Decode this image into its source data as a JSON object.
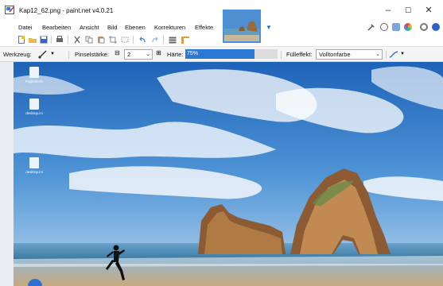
{
  "window": {
    "title": "Kap12_62.png - paint.net v4.0.21",
    "controls": {
      "minimize": "–",
      "maximize": "☐",
      "close": "✕"
    }
  },
  "menu": {
    "items": [
      "Datei",
      "Bearbeiten",
      "Ansicht",
      "Bild",
      "Ebenen",
      "Korrekturen",
      "Effekte"
    ]
  },
  "options_bar": {
    "tool_label": "Werkzeug:",
    "brush_width_label": "Pinselstärke:",
    "brush_width_value": "2",
    "hardness_label": "Härte:",
    "hardness_value": "75%",
    "hardness_fraction": 0.75,
    "fill_label": "Fülleffekt:",
    "fill_value": "Volltonfarbe"
  },
  "desktop": {
    "icons": [
      {
        "label": "Papierkorb",
        "name": "recycle-bin"
      },
      {
        "label": "desktop.ini",
        "name": "file"
      },
      {
        "label": "desktop.ini",
        "name": "file"
      }
    ]
  },
  "colors": {
    "accent": "#2b78d6",
    "sky_top": "#1e63b8",
    "sea": "#3a7fa8",
    "rock": "#b07a45"
  }
}
